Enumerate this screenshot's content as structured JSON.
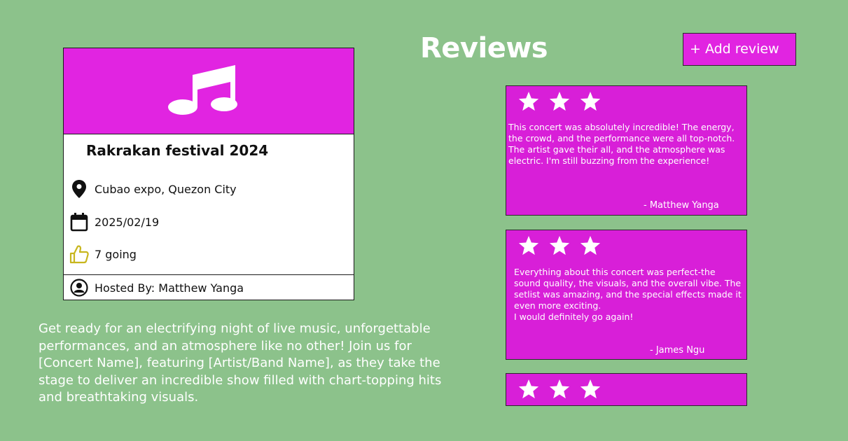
{
  "event": {
    "title": "Rakrakan festival 2024",
    "location": "Cubao expo, Quezon City",
    "date": "2025/02/19",
    "going": "7 going",
    "host": "Hosted By: Matthew Yanga",
    "banner_icon": "music-note-icon"
  },
  "description": "Get ready for an electrifying night of live music, unforgettable performances, and an atmosphere like no other! Join us for [Concert Name], featuring [Artist/Band Name], as they take the stage to deliver an incredible show filled with chart-topping hits and breathtaking visuals.",
  "reviews": {
    "heading": "Reviews",
    "add_label": "+ Add review",
    "items": [
      {
        "stars": 3,
        "text": "This concert was absolutely incredible! The energy, the crowd, and the performance were all top-notch. The artist gave their all, and the atmosphere was electric. I'm still buzzing from the experience!",
        "author": "- Matthew Yanga"
      },
      {
        "stars": 3,
        "text": "Everything about this concert was perfect-the sound quality, the visuals, and the overall vibe. The setlist was amazing, and the special effects made it even more exciting.\nI would definitely go again!",
        "author": "- James Ngu"
      },
      {
        "stars": 3
      }
    ]
  },
  "colors": {
    "background": "#8cc28b",
    "accent_magenta": "#e124e1",
    "review_card": "#d81fd8",
    "thumbs_up_icon": "#c8b61e"
  }
}
